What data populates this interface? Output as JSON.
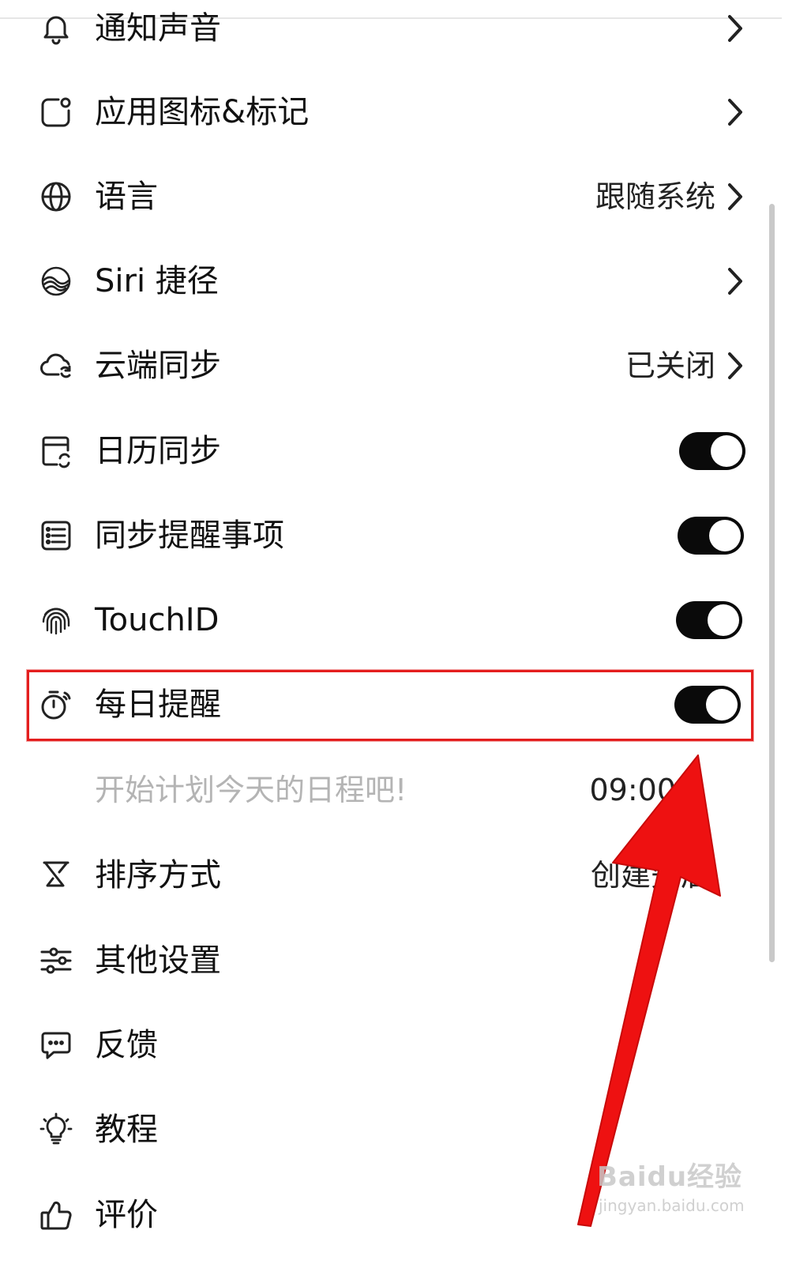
{
  "settings": {
    "items": [
      {
        "id": "notification-sound",
        "label": "通知声音",
        "control": "chevron"
      },
      {
        "id": "app-icon-badge",
        "label": "应用图标&标记",
        "control": "chevron"
      },
      {
        "id": "language",
        "label": "语言",
        "value": "跟随系统",
        "control": "chevron"
      },
      {
        "id": "siri-shortcuts",
        "label": "Siri 捷径",
        "control": "chevron"
      },
      {
        "id": "cloud-sync",
        "label": "云端同步",
        "value": "已关闭",
        "control": "chevron"
      },
      {
        "id": "calendar-sync",
        "label": "日历同步",
        "control": "toggle",
        "on": true
      },
      {
        "id": "reminders-sync",
        "label": "同步提醒事项",
        "control": "toggle",
        "on": true
      },
      {
        "id": "touchid",
        "label": "TouchID",
        "control": "toggle",
        "on": true
      },
      {
        "id": "daily-reminder",
        "label": "每日提醒",
        "control": "toggle",
        "on": true
      },
      {
        "id": "daily-reminder-detail",
        "label": "开始计划今天的日程吧!",
        "value": "09:00"
      },
      {
        "id": "sort-order",
        "label": "排序方式",
        "value": "创建先后"
      },
      {
        "id": "other-settings",
        "label": "其他设置"
      },
      {
        "id": "feedback",
        "label": "反馈"
      },
      {
        "id": "tutorial",
        "label": "教程"
      },
      {
        "id": "rate",
        "label": "评价"
      }
    ]
  },
  "icons": {
    "notification-sound": "bell-icon",
    "app-icon-badge": "app-badge-icon",
    "language": "globe-icon",
    "siri-shortcuts": "siri-icon",
    "cloud-sync": "cloud-sync-icon",
    "calendar-sync": "calendar-sync-icon",
    "reminders-sync": "list-icon",
    "touchid": "fingerprint-icon",
    "daily-reminder": "stopwatch-icon",
    "sort-order": "sort-icon",
    "other-settings": "sliders-icon",
    "feedback": "chat-bubble-icon",
    "tutorial": "lightbulb-icon",
    "rate": "thumbs-up-icon"
  },
  "watermark": {
    "logo": "Baidu经验",
    "url": "jingyan.baidu.com"
  },
  "colors": {
    "toggle_on": "#0a0a0a",
    "highlight": "#e41e1e",
    "arrow": "#ee1111",
    "secondary_text": "#b4b4b4"
  }
}
